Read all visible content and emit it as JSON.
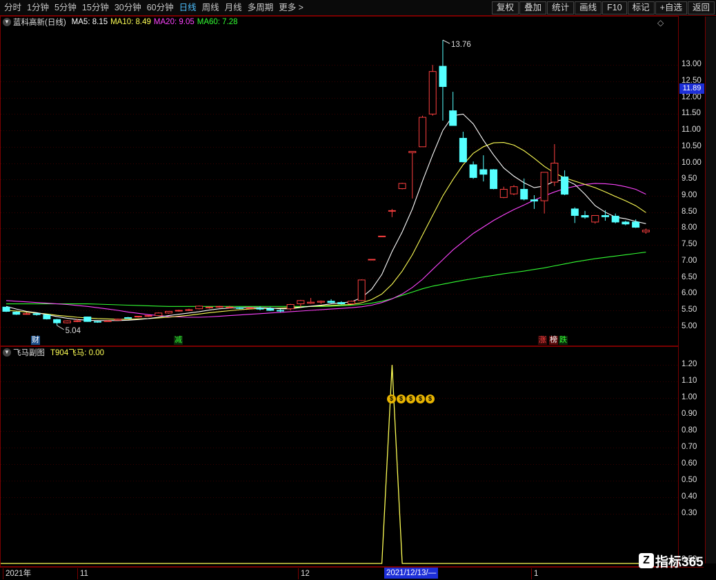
{
  "toolbar": {
    "left": [
      "分时",
      "1分钟",
      "5分钟",
      "15分钟",
      "30分钟",
      "60分钟",
      "日线",
      "周线",
      "月线",
      "多周期",
      "更多 >"
    ],
    "active": "日线",
    "right": [
      "复权",
      "叠加",
      "统计",
      "画线",
      "F10",
      "标记",
      "+自选",
      "返回"
    ]
  },
  "main_legend": {
    "title": "蓝科高新(日线)",
    "items": [
      {
        "label": "MA5: 8.15",
        "color": "#ffffff"
      },
      {
        "label": "MA10: 8.49",
        "color": "#ffff55"
      },
      {
        "label": "MA20: 9.05",
        "color": "#ff44ff"
      },
      {
        "label": "MA60: 7.28",
        "color": "#33ff33"
      }
    ]
  },
  "sub_legend": {
    "title": "飞马副图",
    "items": [
      {
        "label": "T904飞马: 0.00",
        "color": "#ffff55"
      }
    ]
  },
  "current_price": "11.89",
  "colors": {
    "up": "#ff4040",
    "down": "#55ffff",
    "ma5": "#ffffff",
    "ma10": "#ffff55",
    "ma20": "#ff44ff",
    "ma60": "#33ff33",
    "grid": "#7a0000",
    "indicator": "#ffff55"
  },
  "main_axis_ticks": [
    "13.00",
    "12.50",
    "12.00",
    "11.50",
    "11.00",
    "10.50",
    "10.00",
    "9.50",
    "9.00",
    "8.50",
    "8.00",
    "7.50",
    "7.00",
    "6.50",
    "6.00",
    "5.50",
    "5.00"
  ],
  "sub_axis_ticks": [
    "1.20",
    "1.10",
    "1.00",
    "0.90",
    "0.80",
    "0.70",
    "0.60",
    "0.50",
    "0.40",
    "0.30",
    "0.50"
  ],
  "date_ticks": [
    "2021年",
    "11",
    "12",
    "1"
  ],
  "cursor_date": "2021/12/13/—",
  "markers": [
    {
      "text": "财",
      "fg": "#ffffff",
      "bg": "#1d4f8a"
    },
    {
      "text": "减",
      "fg": "#33ff33",
      "bg": "#0b2a0b"
    },
    {
      "text": "涨",
      "fg": "#ff4040",
      "bg": "#3a0a0a"
    },
    {
      "text": "榜",
      "fg": "#ffffff",
      "bg": "#5a0a0a"
    },
    {
      "text": "跌",
      "fg": "#33ff33",
      "bg": "#0b2a0b"
    }
  ],
  "annotations": {
    "high": "13.76",
    "low": "5.04"
  },
  "sub_icons": [
    "$",
    "$",
    "$",
    "$",
    "$"
  ],
  "watermark": "指标365",
  "chart_data": {
    "type": "candlestick",
    "title": "蓝科高新(日线)",
    "ylim": [
      4.7,
      14.1
    ],
    "candles": [
      {
        "o": 5.6,
        "h": 5.6,
        "l": 5.45,
        "c": 5.47
      },
      {
        "o": 5.45,
        "h": 5.47,
        "l": 5.36,
        "c": 5.38
      },
      {
        "o": 5.4,
        "h": 5.44,
        "l": 5.37,
        "c": 5.4
      },
      {
        "o": 5.4,
        "h": 5.42,
        "l": 5.34,
        "c": 5.37
      },
      {
        "o": 5.36,
        "h": 5.38,
        "l": 5.22,
        "c": 5.24
      },
      {
        "o": 5.22,
        "h": 5.24,
        "l": 5.04,
        "c": 5.12
      },
      {
        "o": 5.12,
        "h": 5.2,
        "l": 5.1,
        "c": 5.18
      },
      {
        "o": 5.18,
        "h": 5.24,
        "l": 5.14,
        "c": 5.18
      },
      {
        "o": 5.3,
        "h": 5.31,
        "l": 5.15,
        "c": 5.16
      },
      {
        "o": 5.16,
        "h": 5.18,
        "l": 5.12,
        "c": 5.15
      },
      {
        "o": 5.18,
        "h": 5.2,
        "l": 5.17,
        "c": 5.18
      },
      {
        "o": 5.2,
        "h": 5.25,
        "l": 5.19,
        "c": 5.23
      },
      {
        "o": 5.28,
        "h": 5.3,
        "l": 5.25,
        "c": 5.27
      },
      {
        "o": 5.3,
        "h": 5.33,
        "l": 5.28,
        "c": 5.32
      },
      {
        "o": 5.32,
        "h": 5.36,
        "l": 5.3,
        "c": 5.34
      },
      {
        "o": 5.34,
        "h": 5.44,
        "l": 5.32,
        "c": 5.42
      },
      {
        "o": 5.42,
        "h": 5.48,
        "l": 5.4,
        "c": 5.47
      },
      {
        "o": 5.5,
        "h": 5.52,
        "l": 5.46,
        "c": 5.5
      },
      {
        "o": 5.5,
        "h": 5.55,
        "l": 5.48,
        "c": 5.52
      },
      {
        "o": 5.55,
        "h": 5.65,
        "l": 5.53,
        "c": 5.63
      },
      {
        "o": 5.6,
        "h": 5.62,
        "l": 5.55,
        "c": 5.6
      },
      {
        "o": 5.62,
        "h": 5.64,
        "l": 5.58,
        "c": 5.62
      },
      {
        "o": 5.6,
        "h": 5.64,
        "l": 5.56,
        "c": 5.6
      },
      {
        "o": 5.58,
        "h": 5.6,
        "l": 5.54,
        "c": 5.56
      },
      {
        "o": 5.57,
        "h": 5.6,
        "l": 5.54,
        "c": 5.58
      },
      {
        "o": 5.56,
        "h": 5.62,
        "l": 5.5,
        "c": 5.55
      },
      {
        "o": 5.55,
        "h": 5.6,
        "l": 5.48,
        "c": 5.5
      },
      {
        "o": 5.5,
        "h": 5.54,
        "l": 5.44,
        "c": 5.48
      },
      {
        "o": 5.55,
        "h": 5.7,
        "l": 5.5,
        "c": 5.68
      },
      {
        "o": 5.7,
        "h": 5.82,
        "l": 5.6,
        "c": 5.8
      },
      {
        "o": 5.72,
        "h": 5.88,
        "l": 5.7,
        "c": 5.75
      },
      {
        "o": 5.75,
        "h": 5.8,
        "l": 5.7,
        "c": 5.78
      },
      {
        "o": 5.78,
        "h": 5.84,
        "l": 5.72,
        "c": 5.74
      },
      {
        "o": 5.74,
        "h": 5.78,
        "l": 5.68,
        "c": 5.7
      },
      {
        "o": 5.7,
        "h": 5.8,
        "l": 5.68,
        "c": 5.78
      },
      {
        "o": 5.8,
        "h": 6.45,
        "l": 5.78,
        "c": 6.43
      },
      {
        "o": 7.06,
        "h": 7.06,
        "l": 7.06,
        "c": 7.06
      },
      {
        "o": 7.77,
        "h": 7.77,
        "l": 7.77,
        "c": 7.77
      },
      {
        "o": 8.55,
        "h": 8.6,
        "l": 8.35,
        "c": 8.55
      },
      {
        "o": 9.22,
        "h": 9.4,
        "l": 9.2,
        "c": 9.38
      },
      {
        "o": 10.32,
        "h": 10.36,
        "l": 8.92,
        "c": 10.36
      },
      {
        "o": 10.5,
        "h": 11.45,
        "l": 10.5,
        "c": 11.4
      },
      {
        "o": 11.5,
        "h": 13.0,
        "l": 11.45,
        "c": 12.8
      },
      {
        "o": 12.96,
        "h": 13.76,
        "l": 11.3,
        "c": 12.34
      },
      {
        "o": 11.6,
        "h": 12.18,
        "l": 11.15,
        "c": 11.15
      },
      {
        "o": 10.76,
        "h": 10.96,
        "l": 10.02,
        "c": 10.04
      },
      {
        "o": 9.95,
        "h": 10.05,
        "l": 9.52,
        "c": 9.56
      },
      {
        "o": 9.8,
        "h": 10.24,
        "l": 9.44,
        "c": 9.66
      },
      {
        "o": 9.8,
        "h": 9.82,
        "l": 9.2,
        "c": 9.22
      },
      {
        "o": 8.95,
        "h": 9.28,
        "l": 8.93,
        "c": 9.2
      },
      {
        "o": 9.06,
        "h": 9.33,
        "l": 9.02,
        "c": 9.28
      },
      {
        "o": 9.2,
        "h": 9.53,
        "l": 8.86,
        "c": 8.9
      },
      {
        "o": 8.88,
        "h": 9.02,
        "l": 8.6,
        "c": 8.84
      },
      {
        "o": 8.85,
        "h": 9.72,
        "l": 8.46,
        "c": 9.72
      },
      {
        "o": 9.42,
        "h": 10.58,
        "l": 9.3,
        "c": 10.0
      },
      {
        "o": 9.58,
        "h": 9.78,
        "l": 9.02,
        "c": 9.05
      },
      {
        "o": 8.6,
        "h": 8.65,
        "l": 8.17,
        "c": 8.4
      },
      {
        "o": 8.4,
        "h": 8.54,
        "l": 8.3,
        "c": 8.35
      },
      {
        "o": 8.2,
        "h": 8.4,
        "l": 8.15,
        "c": 8.4
      },
      {
        "o": 8.4,
        "h": 8.56,
        "l": 8.24,
        "c": 8.36
      },
      {
        "o": 8.38,
        "h": 8.46,
        "l": 8.16,
        "c": 8.2
      },
      {
        "o": 8.2,
        "h": 8.24,
        "l": 8.1,
        "c": 8.14
      },
      {
        "o": 8.2,
        "h": 8.28,
        "l": 8.02,
        "c": 8.04
      },
      {
        "o": 7.9,
        "h": 8.0,
        "l": 7.84,
        "c": 7.95
      }
    ],
    "ma5": [
      5.62,
      5.54,
      5.47,
      5.43,
      5.37,
      5.31,
      5.26,
      5.22,
      5.2,
      5.19,
      5.19,
      5.19,
      5.2,
      5.22,
      5.25,
      5.29,
      5.34,
      5.38,
      5.42,
      5.46,
      5.51,
      5.55,
      5.57,
      5.58,
      5.59,
      5.58,
      5.57,
      5.55,
      5.55,
      5.59,
      5.63,
      5.66,
      5.7,
      5.73,
      5.76,
      5.89,
      6.15,
      6.6,
      7.3,
      7.9,
      8.6,
      9.45,
      10.25,
      11.0,
      11.45,
      11.5,
      11.2,
      10.7,
      10.25,
      9.85,
      9.6,
      9.4,
      9.25,
      9.3,
      9.45,
      9.5,
      9.35,
      9.05,
      8.7,
      8.5,
      8.35,
      8.3,
      8.22,
      8.15
    ],
    "ma10": [
      5.5,
      5.48,
      5.45,
      5.42,
      5.39,
      5.35,
      5.32,
      5.29,
      5.27,
      5.25,
      5.24,
      5.23,
      5.23,
      5.24,
      5.25,
      5.27,
      5.29,
      5.32,
      5.35,
      5.39,
      5.43,
      5.46,
      5.49,
      5.52,
      5.54,
      5.56,
      5.56,
      5.57,
      5.58,
      5.6,
      5.62,
      5.64,
      5.65,
      5.67,
      5.68,
      5.73,
      5.83,
      6.0,
      6.3,
      6.7,
      7.2,
      7.8,
      8.4,
      9.0,
      9.5,
      9.95,
      10.3,
      10.5,
      10.62,
      10.63,
      10.55,
      10.38,
      10.15,
      9.9,
      9.7,
      9.55,
      9.45,
      9.35,
      9.25,
      9.12,
      8.98,
      8.85,
      8.7,
      8.49
    ],
    "ma20": [
      5.8,
      5.78,
      5.76,
      5.74,
      5.72,
      5.7,
      5.68,
      5.65,
      5.62,
      5.58,
      5.54,
      5.5,
      5.45,
      5.41,
      5.37,
      5.34,
      5.31,
      5.3,
      5.29,
      5.29,
      5.3,
      5.32,
      5.34,
      5.36,
      5.38,
      5.4,
      5.42,
      5.44,
      5.46,
      5.48,
      5.5,
      5.52,
      5.54,
      5.56,
      5.58,
      5.61,
      5.66,
      5.74,
      5.85,
      6.0,
      6.2,
      6.45,
      6.75,
      7.05,
      7.35,
      7.6,
      7.85,
      8.05,
      8.25,
      8.42,
      8.58,
      8.72,
      8.87,
      9.0,
      9.12,
      9.22,
      9.29,
      9.35,
      9.38,
      9.37,
      9.34,
      9.28,
      9.2,
      9.05
    ],
    "ma60": [
      5.7,
      5.7,
      5.7,
      5.7,
      5.7,
      5.7,
      5.7,
      5.7,
      5.7,
      5.69,
      5.68,
      5.67,
      5.66,
      5.65,
      5.64,
      5.63,
      5.62,
      5.62,
      5.62,
      5.62,
      5.62,
      5.62,
      5.62,
      5.62,
      5.62,
      5.62,
      5.62,
      5.62,
      5.62,
      5.62,
      5.62,
      5.62,
      5.63,
      5.64,
      5.66,
      5.68,
      5.72,
      5.78,
      5.86,
      5.96,
      6.06,
      6.16,
      6.24,
      6.3,
      6.36,
      6.42,
      6.47,
      6.52,
      6.57,
      6.62,
      6.66,
      6.7,
      6.75,
      6.8,
      6.86,
      6.92,
      6.98,
      7.03,
      7.08,
      7.12,
      7.16,
      7.2,
      7.24,
      7.28
    ],
    "indicator": {
      "name": "T904飞马",
      "ylim": [
        0,
        1.28
      ],
      "spike_index": 38,
      "spike_value": 1.2,
      "baseline": 0.0
    }
  }
}
